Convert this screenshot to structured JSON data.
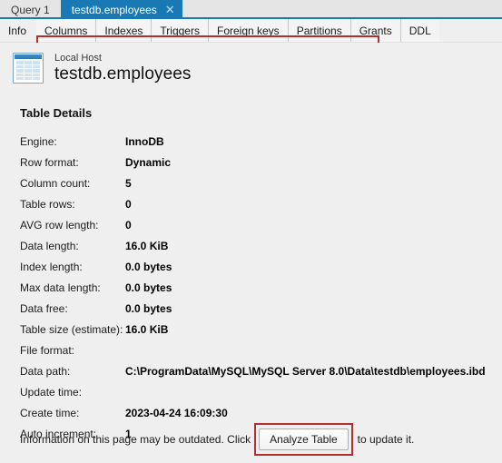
{
  "window": {
    "editor_tabs": [
      {
        "label": "Query 1",
        "active": false,
        "closable": false
      },
      {
        "label": "testdb.employees",
        "active": true,
        "closable": true,
        "close_icon": "close-icon"
      }
    ],
    "accent_color": "#1879b4",
    "background_color": "#efefef",
    "annotation_color": "#b03030"
  },
  "subtabs": {
    "selected": "Info",
    "selected_label": "Info",
    "items": [
      {
        "label": "Columns"
      },
      {
        "label": "Indexes"
      },
      {
        "label": "Triggers"
      },
      {
        "label": "Foreign keys"
      },
      {
        "label": "Partitions"
      },
      {
        "label": "Grants"
      },
      {
        "label": "DDL"
      }
    ]
  },
  "header": {
    "icon": "table-icon",
    "connection": "Local Host",
    "title": "testdb.employees"
  },
  "details": {
    "section_title": "Table Details",
    "rows": [
      {
        "label": "Engine:",
        "value": "InnoDB"
      },
      {
        "label": "Row format:",
        "value": "Dynamic"
      },
      {
        "label": "Column count:",
        "value": "5"
      },
      {
        "label": "Table rows:",
        "value": "0"
      },
      {
        "label": "AVG row length:",
        "value": "0"
      },
      {
        "label": "Data length:",
        "value": "16.0 KiB"
      },
      {
        "label": "Index length:",
        "value": "0.0 bytes"
      },
      {
        "label": "Max data length:",
        "value": "0.0 bytes"
      },
      {
        "label": "Data free:",
        "value": "0.0 bytes"
      },
      {
        "label": "Table size (estimate):",
        "value": "16.0 KiB"
      },
      {
        "label": "File format:",
        "value": ""
      },
      {
        "label": "Data path:",
        "value": "C:\\ProgramData\\MySQL\\MySQL Server 8.0\\Data\\testdb\\employees.ibd"
      },
      {
        "label": "Update time:",
        "value": ""
      },
      {
        "label": "Create time:",
        "value": "2023-04-24 16:09:30"
      },
      {
        "label": "Auto increment:",
        "value": "1"
      }
    ]
  },
  "footer": {
    "text_before": "Information on this page may be outdated. Click",
    "button_label": "Analyze Table",
    "text_after": "to update it."
  }
}
